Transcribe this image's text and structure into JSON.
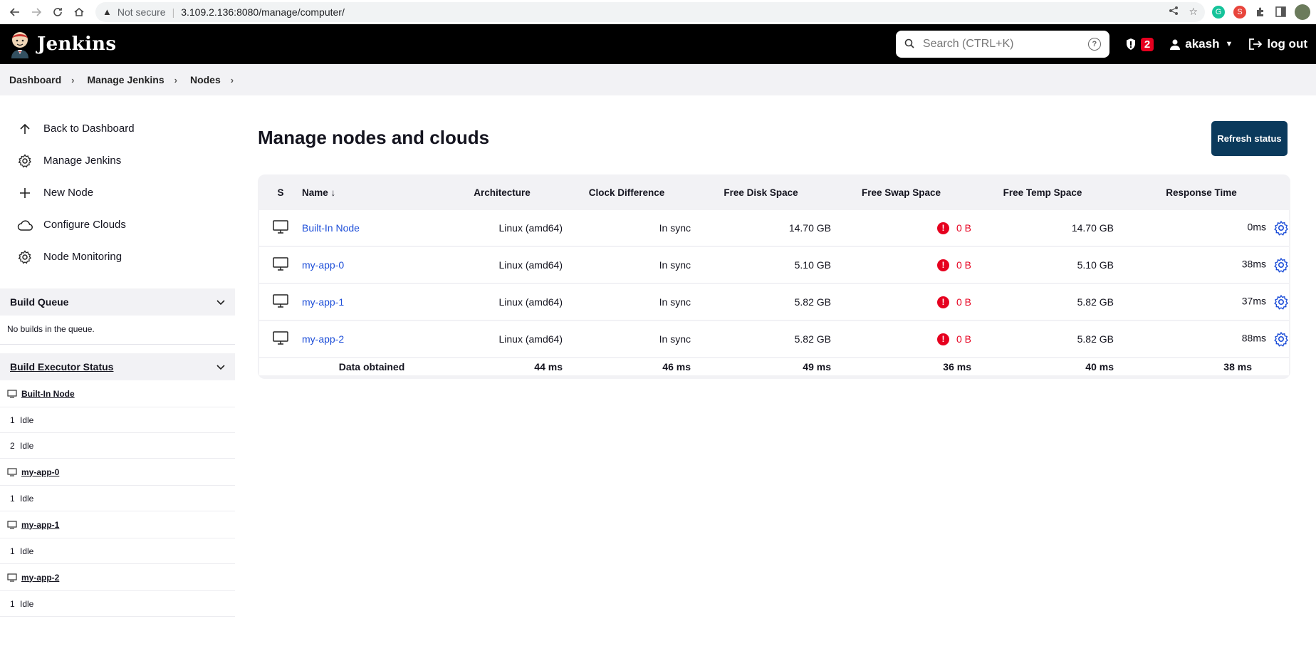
{
  "browser": {
    "not_secure": "Not secure",
    "url": "3.109.2.136:8080/manage/computer/"
  },
  "header": {
    "brand": "Jenkins",
    "search_placeholder": "Search (CTRL+K)",
    "security_count": "2",
    "username": "akash",
    "logout": "log out"
  },
  "breadcrumbs": [
    "Dashboard",
    "Manage Jenkins",
    "Nodes"
  ],
  "sidebar": {
    "tasks": [
      {
        "label": "Back to Dashboard",
        "icon": "arrow-up-icon"
      },
      {
        "label": "Manage Jenkins",
        "icon": "gear-icon"
      },
      {
        "label": "New Node",
        "icon": "plus-icon"
      },
      {
        "label": "Configure Clouds",
        "icon": "cloud-icon"
      },
      {
        "label": "Node Monitoring",
        "icon": "gear-icon"
      }
    ],
    "build_queue": {
      "title": "Build Queue",
      "empty": "No builds in the queue."
    },
    "executor_status": {
      "title": "Build Executor Status",
      "nodes": [
        {
          "name": "Built-In Node",
          "executors": [
            {
              "num": "1",
              "state": "Idle"
            },
            {
              "num": "2",
              "state": "Idle"
            }
          ]
        },
        {
          "name": "my-app-0",
          "executors": [
            {
              "num": "1",
              "state": "Idle"
            }
          ]
        },
        {
          "name": "my-app-1",
          "executors": [
            {
              "num": "1",
              "state": "Idle"
            }
          ]
        },
        {
          "name": "my-app-2",
          "executors": [
            {
              "num": "1",
              "state": "Idle"
            }
          ]
        }
      ]
    }
  },
  "main": {
    "title": "Manage nodes and clouds",
    "refresh_label": "Refresh status",
    "columns": [
      "S",
      "Name",
      "Architecture",
      "Clock Difference",
      "Free Disk Space",
      "Free Swap Space",
      "Free Temp Space",
      "Response Time"
    ],
    "sort_indicator": "↓",
    "nodes": [
      {
        "name": "Built-In Node",
        "arch": "Linux (amd64)",
        "clock": "In sync",
        "disk": "14.70 GB",
        "swap": "0 B",
        "temp": "14.70 GB",
        "response": "0ms"
      },
      {
        "name": "my-app-0",
        "arch": "Linux (amd64)",
        "clock": "In sync",
        "disk": "5.10 GB",
        "swap": "0 B",
        "temp": "5.10 GB",
        "response": "38ms"
      },
      {
        "name": "my-app-1",
        "arch": "Linux (amd64)",
        "clock": "In sync",
        "disk": "5.82 GB",
        "swap": "0 B",
        "temp": "5.82 GB",
        "response": "37ms"
      },
      {
        "name": "my-app-2",
        "arch": "Linux (amd64)",
        "clock": "In sync",
        "disk": "5.82 GB",
        "swap": "0 B",
        "temp": "5.82 GB",
        "response": "88ms"
      }
    ],
    "data_obtained": {
      "label": "Data obtained",
      "arch": "44 ms",
      "clock": "46 ms",
      "disk": "49 ms",
      "swap": "36 ms",
      "temp": "40 ms",
      "response": "38 ms"
    }
  },
  "colors": {
    "accent": "#0b3a5c",
    "link": "#1d4ed8",
    "danger": "#e6001f"
  }
}
